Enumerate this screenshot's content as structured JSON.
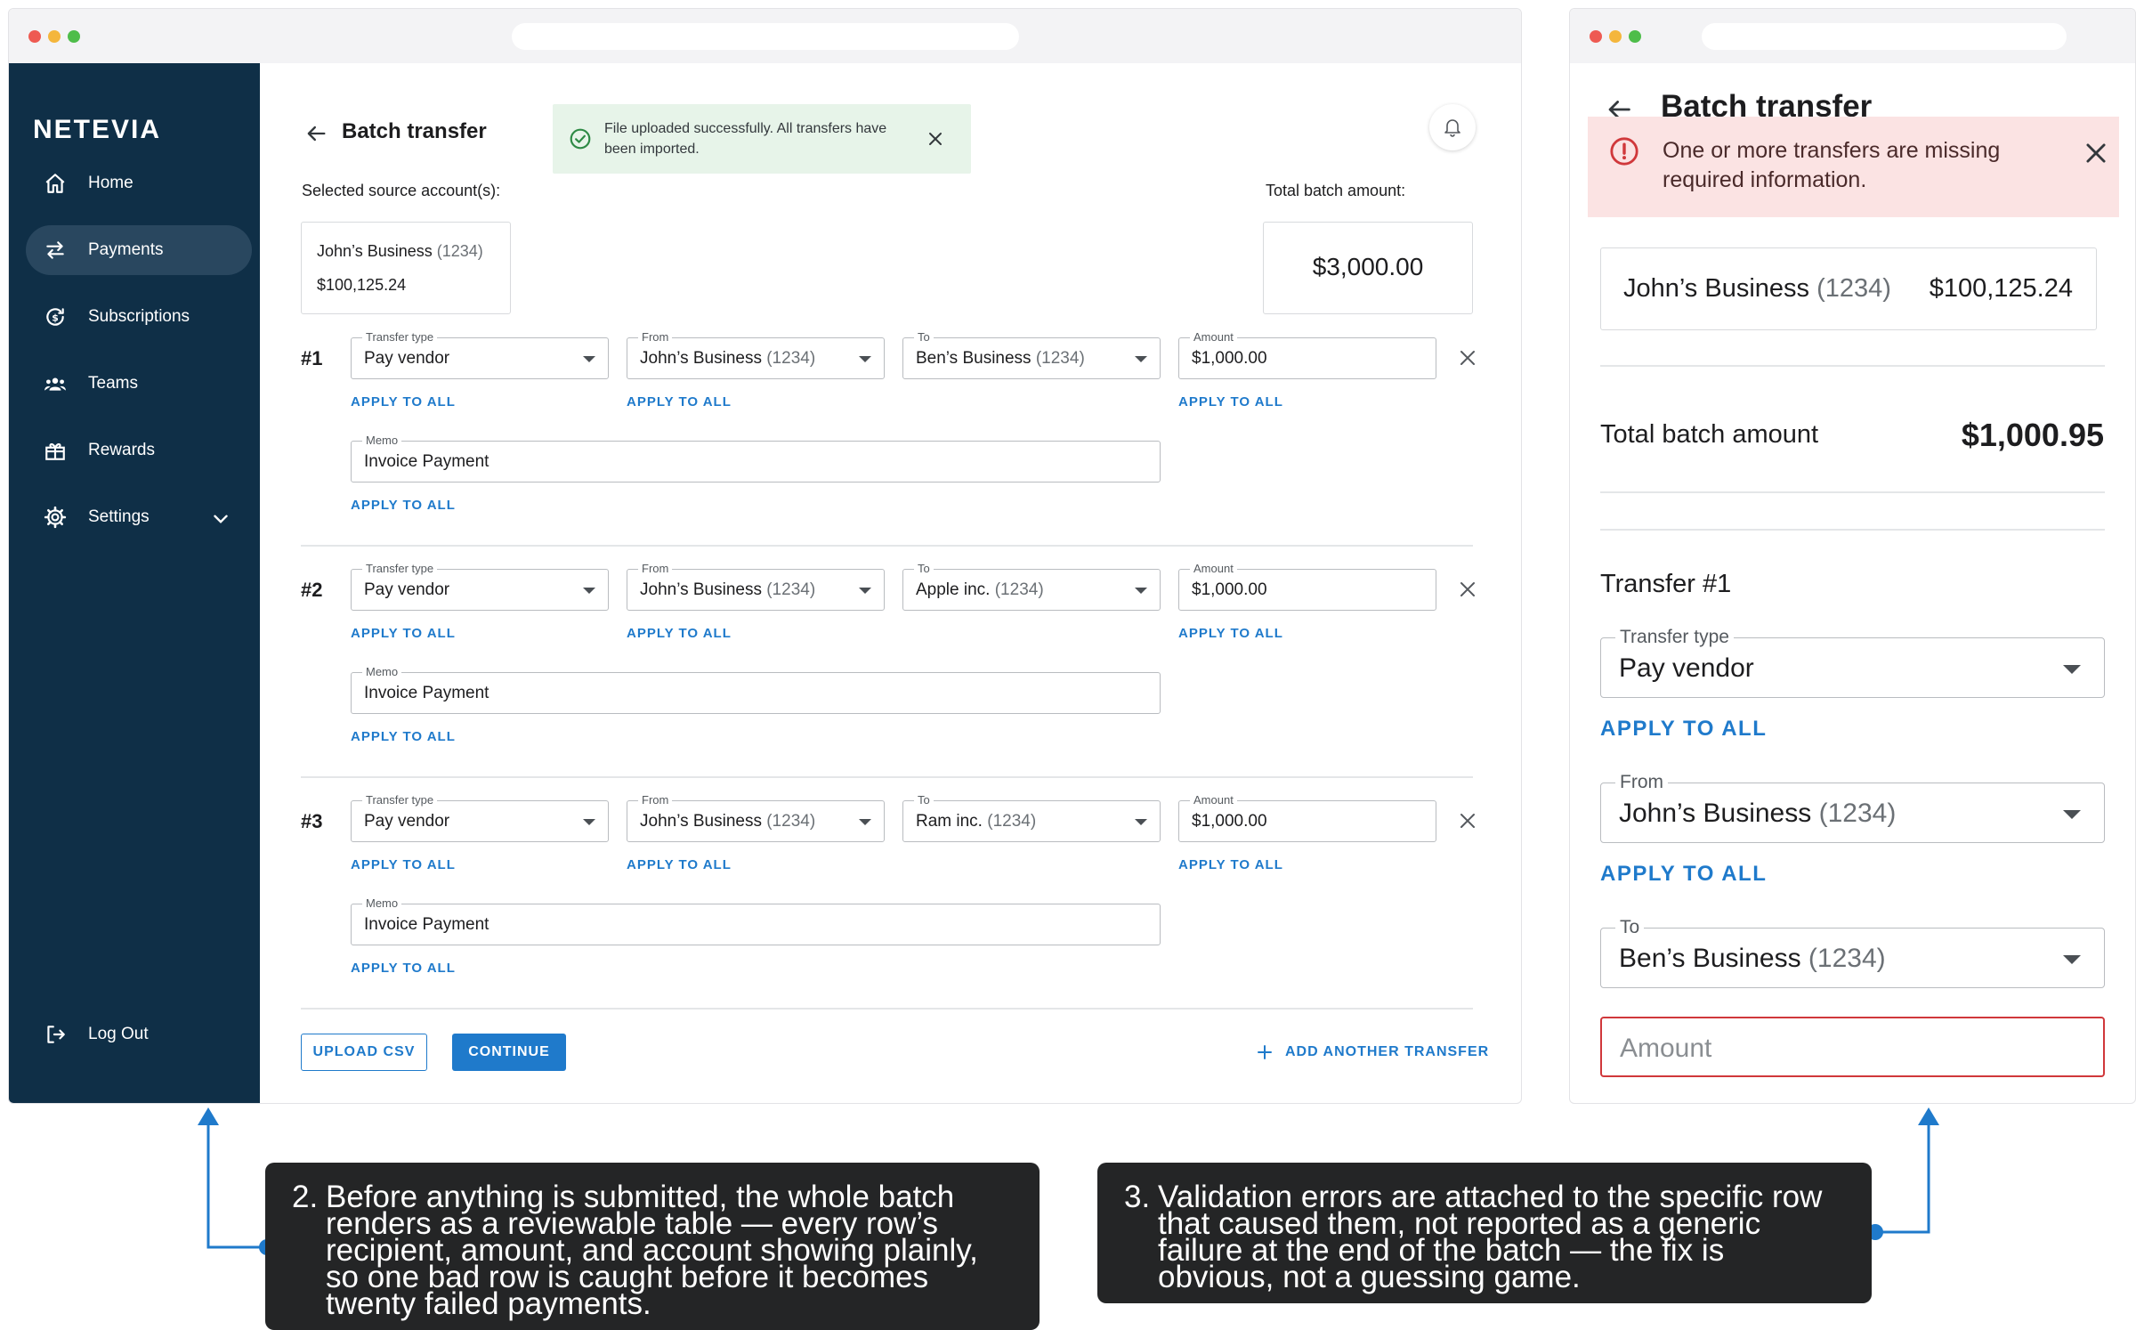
{
  "desktop": {
    "brand": "NETEVIA",
    "nav": [
      {
        "label": "Home"
      },
      {
        "label": "Payments"
      },
      {
        "label": "Subscriptions"
      },
      {
        "label": "Teams"
      },
      {
        "label": "Rewards"
      },
      {
        "label": "Settings"
      }
    ],
    "logout": "Log Out",
    "title": "Batch transfer",
    "toast": "File uploaded successfully. All transfers have been imported.",
    "source_label": "Selected source account(s):",
    "source_account": {
      "name": "John’s Business",
      "number": "(1234)",
      "balance": "$100,125.24"
    },
    "total_label": "Total batch amount:",
    "total_value": "$3,000.00",
    "labels": {
      "type": "Transfer type",
      "from": "From",
      "to": "To",
      "amount": "Amount",
      "memo": "Memo",
      "apply": "APPLY TO ALL"
    },
    "transfers": [
      {
        "num": "#1",
        "type": "Pay vendor",
        "from": "John’s Business",
        "from_num": "(1234)",
        "to": "Ben’s Business",
        "to_num": "(1234)",
        "amount": "$1,000.00",
        "memo": "Invoice Payment"
      },
      {
        "num": "#2",
        "type": "Pay vendor",
        "from": "John’s Business",
        "from_num": "(1234)",
        "to": "Apple inc.",
        "to_num": "(1234)",
        "amount": "$1,000.00",
        "memo": "Invoice Payment"
      },
      {
        "num": "#3",
        "type": "Pay vendor",
        "from": "John’s Business",
        "from_num": "(1234)",
        "to": "Ram inc.",
        "to_num": "(1234)",
        "amount": "$1,000.00",
        "memo": "Invoice Payment"
      }
    ],
    "buttons": {
      "upload": "UPLOAD CSV",
      "continue": "CONTINUE",
      "add": "ADD ANOTHER TRANSFER"
    }
  },
  "mobile": {
    "title": "Batch transfer",
    "error": "One or more transfers are missing required information.",
    "account": {
      "name": "John’s Business",
      "number": "(1234)",
      "balance": "$100,125.24"
    },
    "total_label": "Total batch amount",
    "total_value": "$1,000.95",
    "transfer_title": "Transfer #1",
    "labels": {
      "type": "Transfer type",
      "from": "From",
      "to": "To",
      "apply": "APPLY TO ALL"
    },
    "type": "Pay vendor",
    "from": "John’s Business",
    "from_num": "(1234)",
    "to": "Ben’s Business",
    "to_num": "(1234)",
    "amount_placeholder": "Amount"
  },
  "notes": [
    {
      "num": "2.",
      "lines": [
        "Before anything is submitted, the whole batch",
        "renders as a reviewable table — every row’s",
        "recipient, amount, and account showing plainly,",
        "so one bad row is caught before it becomes",
        "twenty failed payments."
      ]
    },
    {
      "num": "3.",
      "lines": [
        "Validation errors are attached to the specific row",
        "that caused them, not reported as a generic",
        "failure at the end of the batch — the fix is",
        "obvious, not a guessing game."
      ]
    }
  ],
  "colors": {
    "sidebar": "#0f2f47",
    "accent": "#1f7acb",
    "success_bg": "#e7f4e9",
    "error_bg": "#fbe3e3",
    "error": "#d0383b"
  }
}
